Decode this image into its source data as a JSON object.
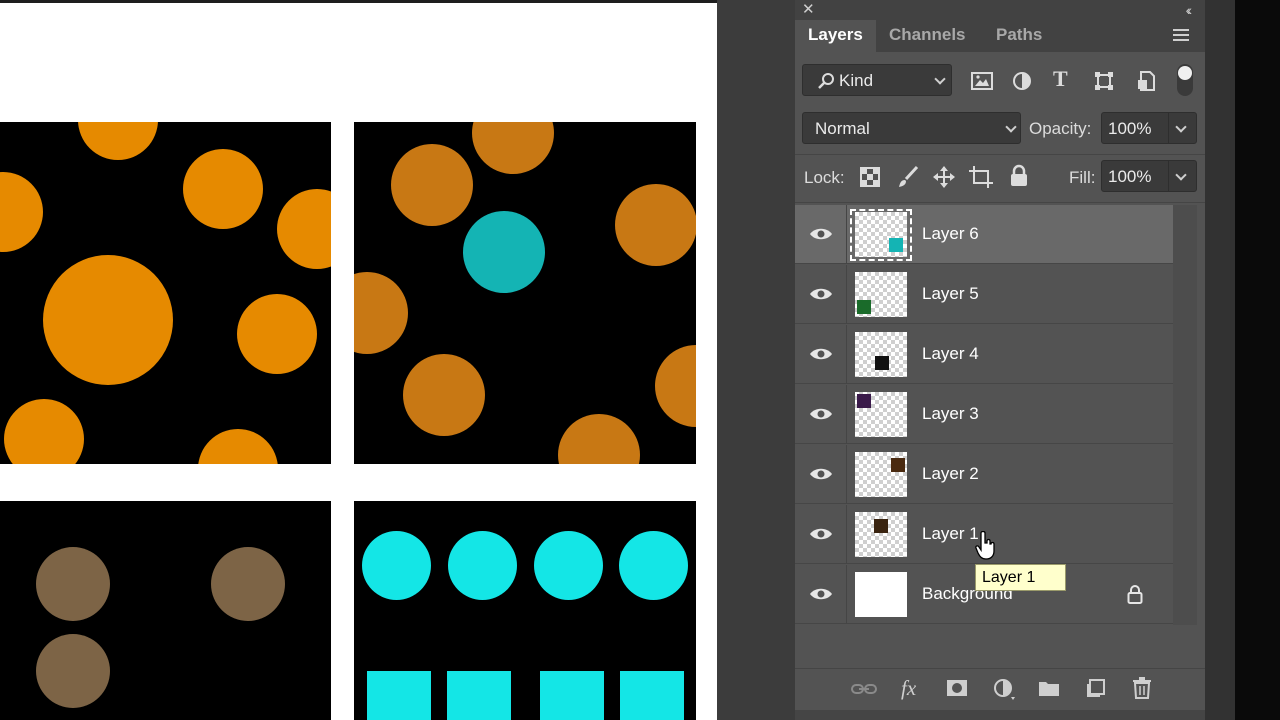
{
  "panel": {
    "tabs": [
      {
        "label": "Layers",
        "active": true
      },
      {
        "label": "Channels",
        "active": false
      },
      {
        "label": "Paths",
        "active": false
      }
    ],
    "filter": {
      "label": "Kind"
    },
    "blend_mode": {
      "value": "Normal"
    },
    "opacity": {
      "label": "Opacity:",
      "value": "100%"
    },
    "lock": {
      "label": "Lock:"
    },
    "fill": {
      "label": "Fill:",
      "value": "100%"
    },
    "layers": [
      {
        "name": "Layer 6",
        "visible": true,
        "selected": true,
        "locked": false
      },
      {
        "name": "Layer 5",
        "visible": true,
        "selected": false,
        "locked": false
      },
      {
        "name": "Layer 4",
        "visible": true,
        "selected": false,
        "locked": false
      },
      {
        "name": "Layer 3",
        "visible": true,
        "selected": false,
        "locked": false
      },
      {
        "name": "Layer 2",
        "visible": true,
        "selected": false,
        "locked": false
      },
      {
        "name": "Layer 1",
        "visible": true,
        "selected": false,
        "locked": false
      },
      {
        "name": "Background",
        "visible": true,
        "selected": false,
        "locked": true
      }
    ]
  },
  "tooltip": {
    "text": "Layer 1"
  },
  "colors": {
    "orange": "#e68a00",
    "dark_orange": "#c87814",
    "teal": "#14b4b4",
    "brown": "#7d6446",
    "cyan": "#14e6e6"
  }
}
